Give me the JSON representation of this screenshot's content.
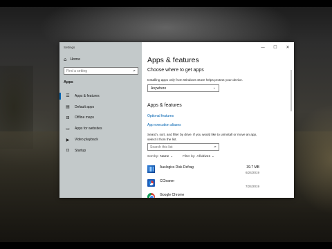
{
  "window": {
    "title": "Settings",
    "minimize_glyph": "—",
    "maximize_glyph": "☐",
    "close_glyph": "✕"
  },
  "sidebar": {
    "home_label": "Home",
    "home_icon": "⌂",
    "search_placeholder": "Find a setting",
    "search_icon": "⌕",
    "section_label": "Apps",
    "items": [
      {
        "label": "Apps & features",
        "icon": "☰",
        "icon_name": "apps-features-icon",
        "active": true
      },
      {
        "label": "Default apps",
        "icon": "▤",
        "icon_name": "default-apps-icon",
        "active": false
      },
      {
        "label": "Offline maps",
        "icon": "⊞",
        "icon_name": "offline-maps-icon",
        "active": false
      },
      {
        "label": "Apps for websites",
        "icon": "▭",
        "icon_name": "apps-websites-icon",
        "active": false
      },
      {
        "label": "Video playback",
        "icon": "▶",
        "icon_name": "video-playback-icon",
        "active": false
      },
      {
        "label": "Startup",
        "icon": "⊡",
        "icon_name": "startup-icon",
        "active": false
      }
    ]
  },
  "main": {
    "title": "Apps & features",
    "choose_heading": "Choose where to get apps",
    "choose_desc": "Installing apps only from Windows Store helps protect your device.",
    "source_dropdown": {
      "value": "Anywhere",
      "chevron": "⌄"
    },
    "apps_heading": "Apps & features",
    "optional_features_link": "Optional features",
    "app_aliases_link": "App execution aliases",
    "list_desc": "Search, sort, and filter by drive. If you would like to uninstall or move an app, select it from the list.",
    "list_search_placeholder": "Search this list",
    "list_search_icon": "⌕",
    "sort_label": "Sort by:",
    "sort_value": "Name",
    "filter_label": "Filter by:",
    "filter_value": "All drives",
    "chevron": "⌄",
    "apps": [
      {
        "name": "Auslogics Disk Defrag",
        "size": "39.7 MB",
        "date": "6/24/2019",
        "icon_name": "auslogics-disk-defrag-icon"
      },
      {
        "name": "CCleaner",
        "size": "",
        "date": "7/24/2019",
        "icon_name": "ccleaner-icon"
      },
      {
        "name": "Google Chrome",
        "size": "",
        "date": "",
        "icon_name": "google-chrome-icon"
      }
    ]
  },
  "colors": {
    "accent": "#0063b1",
    "sidebar_bg": "#bec4c6"
  }
}
